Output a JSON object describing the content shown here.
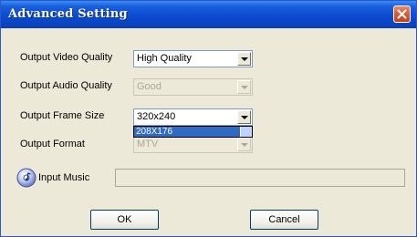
{
  "window": {
    "title": "Advanced Setting"
  },
  "fields": {
    "video_quality": {
      "label": "Output Video Quality",
      "value": "High Quality",
      "enabled": true
    },
    "audio_quality": {
      "label": "Output Audio Quality",
      "value": "Good",
      "enabled": false
    },
    "frame_size": {
      "label": "Output Frame Size",
      "value": "320x240",
      "enabled": true,
      "open_list_items": [
        "208X176"
      ],
      "highlighted_item": "208X176"
    },
    "output_format": {
      "label": "Output Format",
      "value": "MTV",
      "enabled": false
    },
    "input_music": {
      "label": "Input Music",
      "value": "",
      "icon": "music-disc-icon"
    }
  },
  "buttons": {
    "ok_label": "OK",
    "cancel_label": "Cancel"
  },
  "colors": {
    "title_bar": "#0b4bd1",
    "close_button": "#d85a36",
    "dialog_bg": "#ece9d8",
    "selection": "#316ac5"
  }
}
